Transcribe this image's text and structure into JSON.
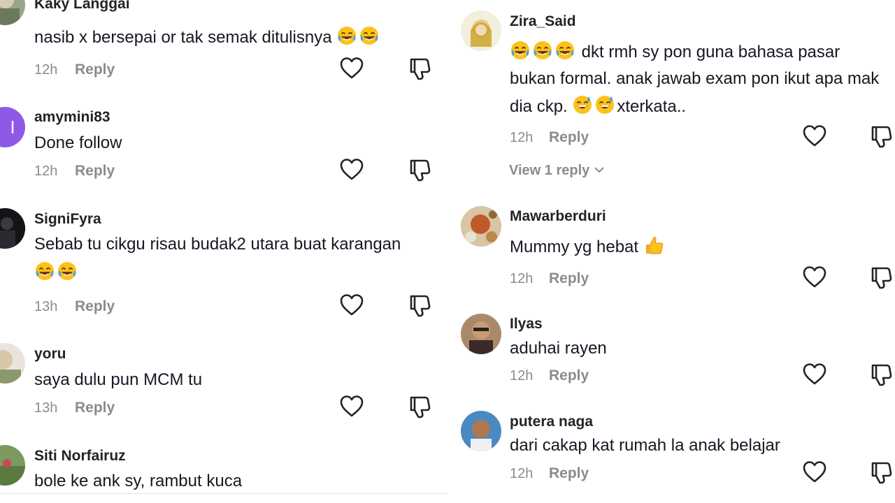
{
  "left": {
    "comments": [
      {
        "username": "Kaky Langgai",
        "text": "nasib x bersepai or tak semak ditulisnya",
        "emoji": [
          "joy-icon",
          "joy-icon"
        ],
        "time": "12h",
        "reply": "Reply"
      },
      {
        "username": "amymini83",
        "avatar_letter": "I",
        "avatar_color": "#8e59e6",
        "text": "Done follow",
        "time": "12h",
        "reply": "Reply"
      },
      {
        "username": "SigniFyra",
        "text_lines": [
          "Sebab tu cikgu risau budak2 utara buat karangan",
          ""
        ],
        "emoji": [
          "joy-icon",
          "joy-icon"
        ],
        "time": "13h",
        "reply": "Reply"
      },
      {
        "username": "yoru",
        "text": "saya dulu pun MCM tu",
        "time": "13h",
        "reply": "Reply"
      },
      {
        "username": "Siti Norfairuz",
        "text": "bole ke ank sy, rambut kuca"
      }
    ]
  },
  "right": {
    "comments": [
      {
        "username": "Zira_Said",
        "text_lines": [
          " dkt rmh sy pon guna bahasa pasar",
          "bukan formal. anak jawab exam pon ikut apa mak",
          "dia ckp. ",
          "xterkata.."
        ],
        "time": "12h",
        "reply": "Reply",
        "view_replies": "View 1 reply"
      },
      {
        "username": "Mawarberduri",
        "text": "Mummy yg hebat ",
        "time": "12h",
        "reply": "Reply"
      },
      {
        "username": "Ilyas",
        "text": "aduhai rayen",
        "time": "12h",
        "reply": "Reply"
      },
      {
        "username": "putera naga",
        "text": "dari cakap kat rumah la anak belajar",
        "time": "12h",
        "reply": "Reply"
      }
    ]
  },
  "colors": {
    "accent_meta": "#8a8b91",
    "text": "#161823",
    "avatar_purple": "#8e59e6"
  }
}
